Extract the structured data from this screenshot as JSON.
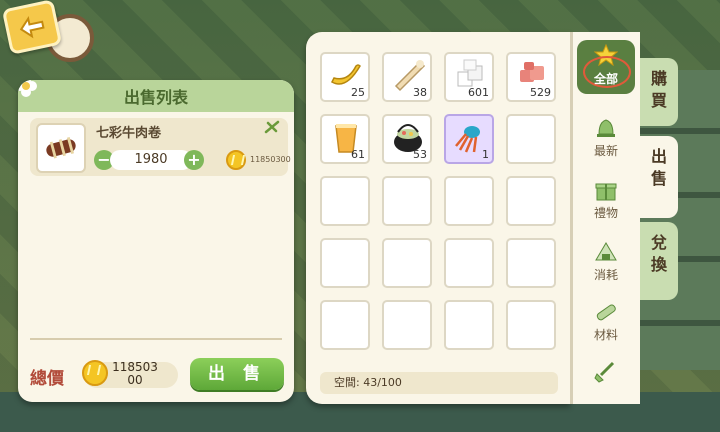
{
  "sell_list": {
    "title": "出售列表",
    "item": {
      "name": "七彩牛肉卷",
      "quantity": "1980",
      "price": "11850300"
    },
    "total_label": "總價",
    "total_value_line1": "118503",
    "total_value_line2": "00",
    "sell_button": "出 售"
  },
  "inventory": {
    "slots": [
      {
        "icon": "banana-icon",
        "count": "25"
      },
      {
        "icon": "piping-bag-icon",
        "count": "38"
      },
      {
        "icon": "sugar-cubes-icon",
        "count": "601"
      },
      {
        "icon": "meat-chunks-icon",
        "count": "529"
      },
      {
        "icon": "juice-glass-icon",
        "count": "61"
      },
      {
        "icon": "cooking-pot-icon",
        "count": "53"
      },
      {
        "icon": "spider-crab-icon",
        "count": "1",
        "selected": true
      }
    ],
    "capacity": "空間:   43/100"
  },
  "categories": {
    "all": "全部",
    "items": [
      "最新",
      "禮物",
      "消耗",
      "材料"
    ]
  },
  "tabs": {
    "buy": "購買",
    "sell": "出售",
    "exchange": "兌換"
  },
  "colors": {
    "accent_green": "#7fb85a",
    "panel_bg": "#faf6e8",
    "total_red": "#b24b3a"
  }
}
